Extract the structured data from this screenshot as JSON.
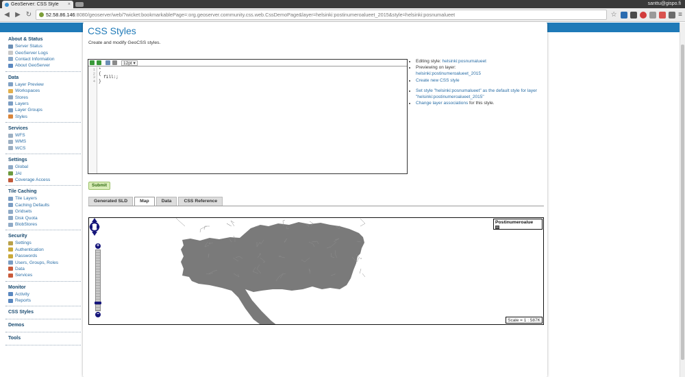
{
  "browser": {
    "tab_title": "GeoServer: CSS Style",
    "user": "santtu@gispo.fi",
    "url_host": "52.58.86.146",
    "url_rest": ":8080/geoserver/web/?wicket:bookmarkablePage=:org.geoserver.community.css.web.CssDemoPage&layer=helsinki:postinumeroalueet_2015&style=helsinki:posnumalueet"
  },
  "sidebar": {
    "sections": [
      {
        "title": "About & Status",
        "items": [
          {
            "label": "Server Status",
            "icon": "server-icon",
            "color": "#6b8fb5"
          },
          {
            "label": "GeoServer Logs",
            "icon": "document-icon",
            "color": "#c8c8c8"
          },
          {
            "label": "Contact Information",
            "icon": "contact-icon",
            "color": "#8aa8c8"
          },
          {
            "label": "About GeoServer",
            "icon": "info-icon",
            "color": "#5a88c0"
          }
        ]
      },
      {
        "title": "Data",
        "items": [
          {
            "label": "Layer Preview",
            "icon": "layer-preview-icon",
            "color": "#7ea0c4"
          },
          {
            "label": "Workspaces",
            "icon": "folder-icon",
            "color": "#e3b04b"
          },
          {
            "label": "Stores",
            "icon": "store-icon",
            "color": "#8fa6bd"
          },
          {
            "label": "Layers",
            "icon": "layers-icon",
            "color": "#7b9dc3"
          },
          {
            "label": "Layer Groups",
            "icon": "layer-groups-icon",
            "color": "#7b9dc3"
          },
          {
            "label": "Styles",
            "icon": "palette-icon",
            "color": "#d9853b"
          }
        ]
      },
      {
        "title": "Services",
        "items": [
          {
            "label": "WFS",
            "icon": "wfs-icon",
            "color": "#9db0c3"
          },
          {
            "label": "WMS",
            "icon": "wms-icon",
            "color": "#9db0c3"
          },
          {
            "label": "WCS",
            "icon": "wcs-icon",
            "color": "#9db0c3"
          }
        ]
      },
      {
        "title": "Settings",
        "items": [
          {
            "label": "Global",
            "icon": "global-icon",
            "color": "#8faac6"
          },
          {
            "label": "JAI",
            "icon": "jai-icon",
            "color": "#6c9a3e"
          },
          {
            "label": "Coverage Access",
            "icon": "coverage-access-icon",
            "color": "#c25a3a"
          }
        ]
      },
      {
        "title": "Tile Caching",
        "items": [
          {
            "label": "Tile Layers",
            "icon": "tile-layers-icon",
            "color": "#7b9dc3"
          },
          {
            "label": "Caching Defaults",
            "icon": "caching-defaults-icon",
            "color": "#7b9dc3"
          },
          {
            "label": "Gridsets",
            "icon": "gridsets-icon",
            "color": "#8faac6"
          },
          {
            "label": "Disk Quota",
            "icon": "disk-quota-icon",
            "color": "#8faac6"
          },
          {
            "label": "BlobStores",
            "icon": "blobstores-icon",
            "color": "#8faac6"
          }
        ]
      },
      {
        "title": "Security",
        "items": [
          {
            "label": "Settings",
            "icon": "key-icon",
            "color": "#b9a14a"
          },
          {
            "label": "Authentication",
            "icon": "lock-icon",
            "color": "#c9a93a"
          },
          {
            "label": "Passwords",
            "icon": "password-icon",
            "color": "#c9a93a"
          },
          {
            "label": "Users, Groups, Roles",
            "icon": "users-icon",
            "color": "#7b9dc3"
          },
          {
            "label": "Data",
            "icon": "data-security-icon",
            "color": "#c95a3a"
          },
          {
            "label": "Services",
            "icon": "services-security-icon",
            "color": "#c95a3a"
          }
        ]
      },
      {
        "title": "Monitor",
        "items": [
          {
            "label": "Activity",
            "icon": "activity-icon",
            "color": "#5a88c0"
          },
          {
            "label": "Reports",
            "icon": "reports-icon",
            "color": "#5a88c0"
          }
        ]
      },
      {
        "title": "CSS Styles",
        "items": []
      },
      {
        "title": "Demos",
        "items": []
      },
      {
        "title": "Tools",
        "items": []
      }
    ]
  },
  "main": {
    "title": "CSS Styles",
    "subtitle": "Create and modify GeoCSS styles.",
    "editor": {
      "font_size": "12pt ▾",
      "line_numbers": [
        "1",
        "2",
        "3",
        "4"
      ],
      "code": "*\n{\n  fill:;\n}"
    },
    "info": {
      "editing_prefix": "Editing style:",
      "editing_link": "helsinki:posnumalueet",
      "previewing_prefix": "Previewing on layer:",
      "previewing_link": "helsinki:postinumeroalueet_2015",
      "create_new": "Create new CSS style",
      "set_default": "Set style \"helsinki:posnumalueet\" as the default style for layer \"helsinki:postinumeroalueet_2015\"",
      "change_assoc_link": "Change layer associations",
      "change_assoc_suffix": " for this style."
    },
    "submit_label": "Submit",
    "tabs": [
      {
        "label": "Generated SLD",
        "active": false
      },
      {
        "label": "Map",
        "active": true
      },
      {
        "label": "Data",
        "active": false
      },
      {
        "label": "CSS Reference",
        "active": false
      }
    ],
    "map": {
      "legend_title": "Postinumeroalue",
      "scale_text": "Scale = 1 : 587K",
      "fill_color": "#7a7a7a"
    }
  }
}
